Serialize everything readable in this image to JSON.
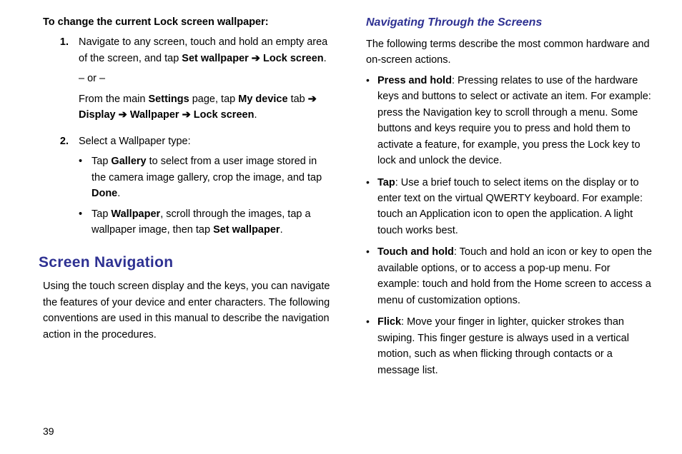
{
  "pageNumber": "39",
  "left": {
    "lead": "To change the current Lock screen wallpaper:",
    "step1": {
      "num": "1.",
      "a1": "Navigate to any screen, touch and hold an empty area of the screen, and tap ",
      "b1": "Set wallpaper",
      "arrow": " ➔ ",
      "b2": "Lock screen",
      "a2": ".",
      "or": "– or –",
      "a3": "From the main ",
      "b3": "Settings",
      "a4": " page, tap ",
      "b4": "My device",
      "a5": " tab ",
      "b5": "Display",
      "b6": "Wallpaper",
      "b7": "Lock screen",
      "a6": "."
    },
    "step2": {
      "num": "2.",
      "a1": "Select a Wallpaper type:",
      "bullet1": {
        "t1": "Tap ",
        "b1": "Gallery",
        "t2": " to select from a user image stored in the camera image gallery, crop the image, and tap ",
        "b2": "Done",
        "t3": "."
      },
      "bullet2": {
        "t1": "Tap ",
        "b1": "Wallpaper",
        "t2": ", scroll through the images, tap a wallpaper image, then tap ",
        "b2": "Set wallpaper",
        "t3": "."
      }
    },
    "heading": "Screen Navigation",
    "para": "Using the touch screen display and the keys, you can navigate the features of your device and enter characters. The following conventions are used in this manual to describe the navigation action in the procedures."
  },
  "right": {
    "heading": "Navigating Through the Screens",
    "intro": "The following terms describe the most common hardware and on-screen actions.",
    "items": [
      {
        "term": "Press and hold",
        "desc": ": Pressing relates to use of the hardware keys and buttons to select or activate an item. For example: press the Navigation key to scroll through a menu. Some buttons and keys require you to press and hold them to activate a feature, for example, you press the Lock key to lock and unlock the device."
      },
      {
        "term": "Tap",
        "desc": ": Use a brief touch to select items on the display or to enter text on the virtual QWERTY keyboard. For example: touch an Application icon to open the application. A light touch works best."
      },
      {
        "term": "Touch and hold",
        "desc": ": Touch and hold an icon or key to open the available options, or to access a pop-up menu. For example: touch and hold from the Home screen to access a menu of customization options."
      },
      {
        "term": "Flick",
        "desc": ": Move your finger in lighter, quicker strokes than swiping. This finger gesture is always used in a vertical motion, such as when flicking through contacts or a message list."
      }
    ]
  }
}
